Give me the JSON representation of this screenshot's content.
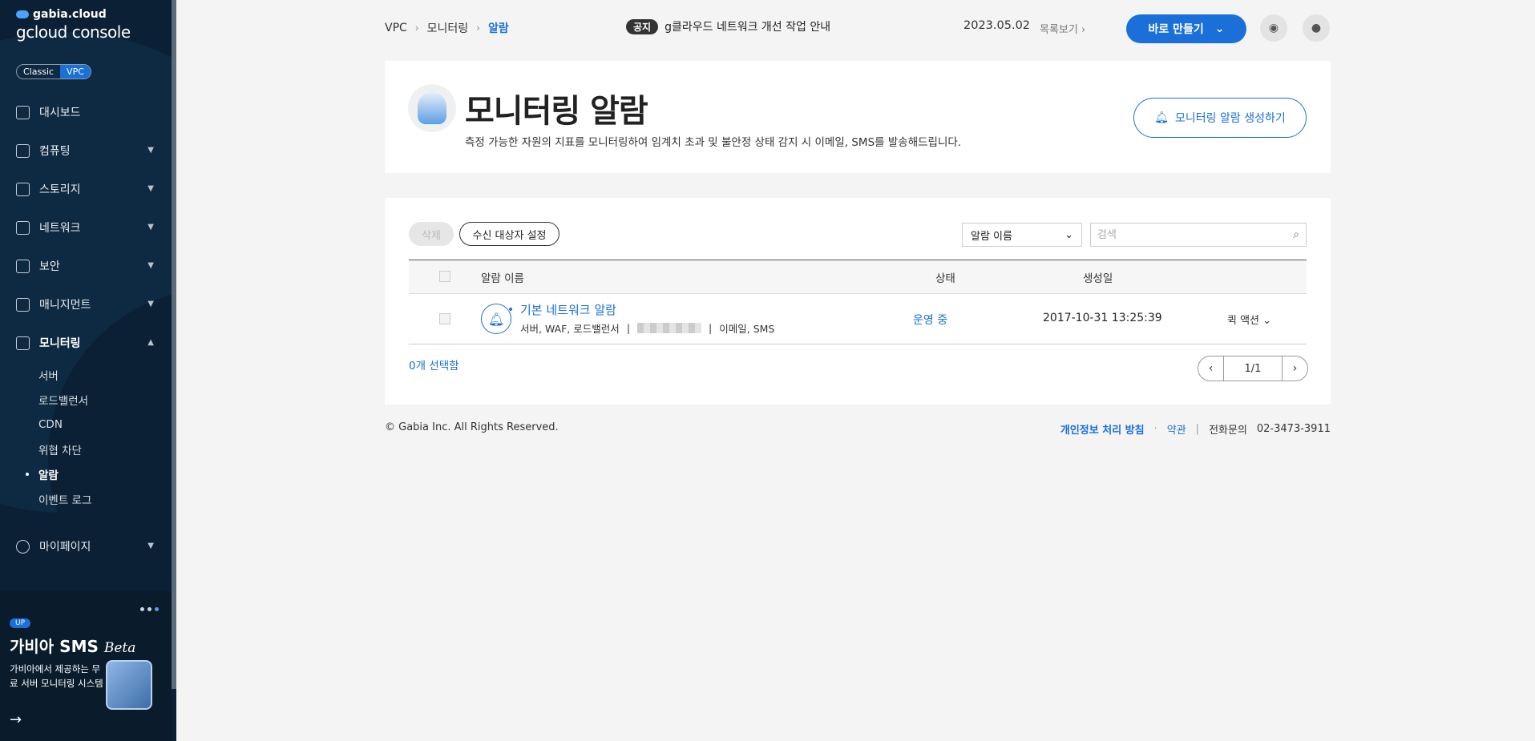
{
  "sidebar": {
    "brand_small": "gabia.cloud",
    "brand_large": "gcloud console",
    "mode": {
      "classic": "Classic",
      "vpc": "VPC"
    },
    "items": [
      {
        "label": "대시보드",
        "icon": "dashboard-icon"
      },
      {
        "label": "컴퓨팅",
        "icon": "cpu-icon"
      },
      {
        "label": "스토리지",
        "icon": "storage-icon"
      },
      {
        "label": "네트워크",
        "icon": "network-icon"
      },
      {
        "label": "보안",
        "icon": "shield-icon"
      },
      {
        "label": "매니지먼트",
        "icon": "management-icon"
      },
      {
        "label": "모니터링",
        "icon": "monitoring-icon"
      },
      {
        "label": "마이페이지",
        "icon": "user-icon"
      }
    ],
    "subitems": [
      "서버",
      "로드밸런서",
      "CDN",
      "위협 차단",
      "알람",
      "이벤트 로그"
    ],
    "promo": {
      "badge": "UP",
      "title": "가비아 SMS",
      "title_italic": "Beta",
      "desc": "가비아에서 제공하는 무료 서버 모니터링 시스템"
    }
  },
  "header": {
    "breadcrumb": [
      "VPC",
      "모니터링",
      "알람"
    ],
    "notice_tag": "공지",
    "notice_text": "g클라우드 네트워크 개선 작업 안내",
    "notice_date": "2023.05.02",
    "notice_list": "목록보기",
    "make_button": "바로 만들기"
  },
  "intro": {
    "title": "모니터링 알람",
    "description": "측정 가능한 자원의 지표를 모니터링하여 임계치 초과 및 불안정 상태 감지 시 이메일, SMS를 발송해드립니다.",
    "create_button": "모니터링 알람 생성하기"
  },
  "toolbar": {
    "delete_label": "삭제",
    "recipient_label": "수신 대상자 설정",
    "filter_selected": "알람 이름",
    "search_placeholder": "검색"
  },
  "table": {
    "columns": [
      "알람 이름",
      "상태",
      "생성일"
    ],
    "rows": [
      {
        "name": "기본 네트워크 알람",
        "targets": "서버, WAF, 로드밸런서",
        "channels": "이메일, SMS",
        "status": "운영 중",
        "created": "2017-10-31 13:25:39",
        "action": "퀵 액션"
      }
    ],
    "selected_count": "0개 선택함",
    "pagination": "1/1"
  },
  "footer": {
    "copyright": "© Gabia Inc. All Rights Reserved.",
    "privacy": "개인정보 처리 방침",
    "terms": "약관",
    "phone_label": "전화문의",
    "phone": "02-3473-3911"
  },
  "colors": {
    "accent": "#1a6fd8",
    "sidebar_bg": "#0b2035"
  }
}
